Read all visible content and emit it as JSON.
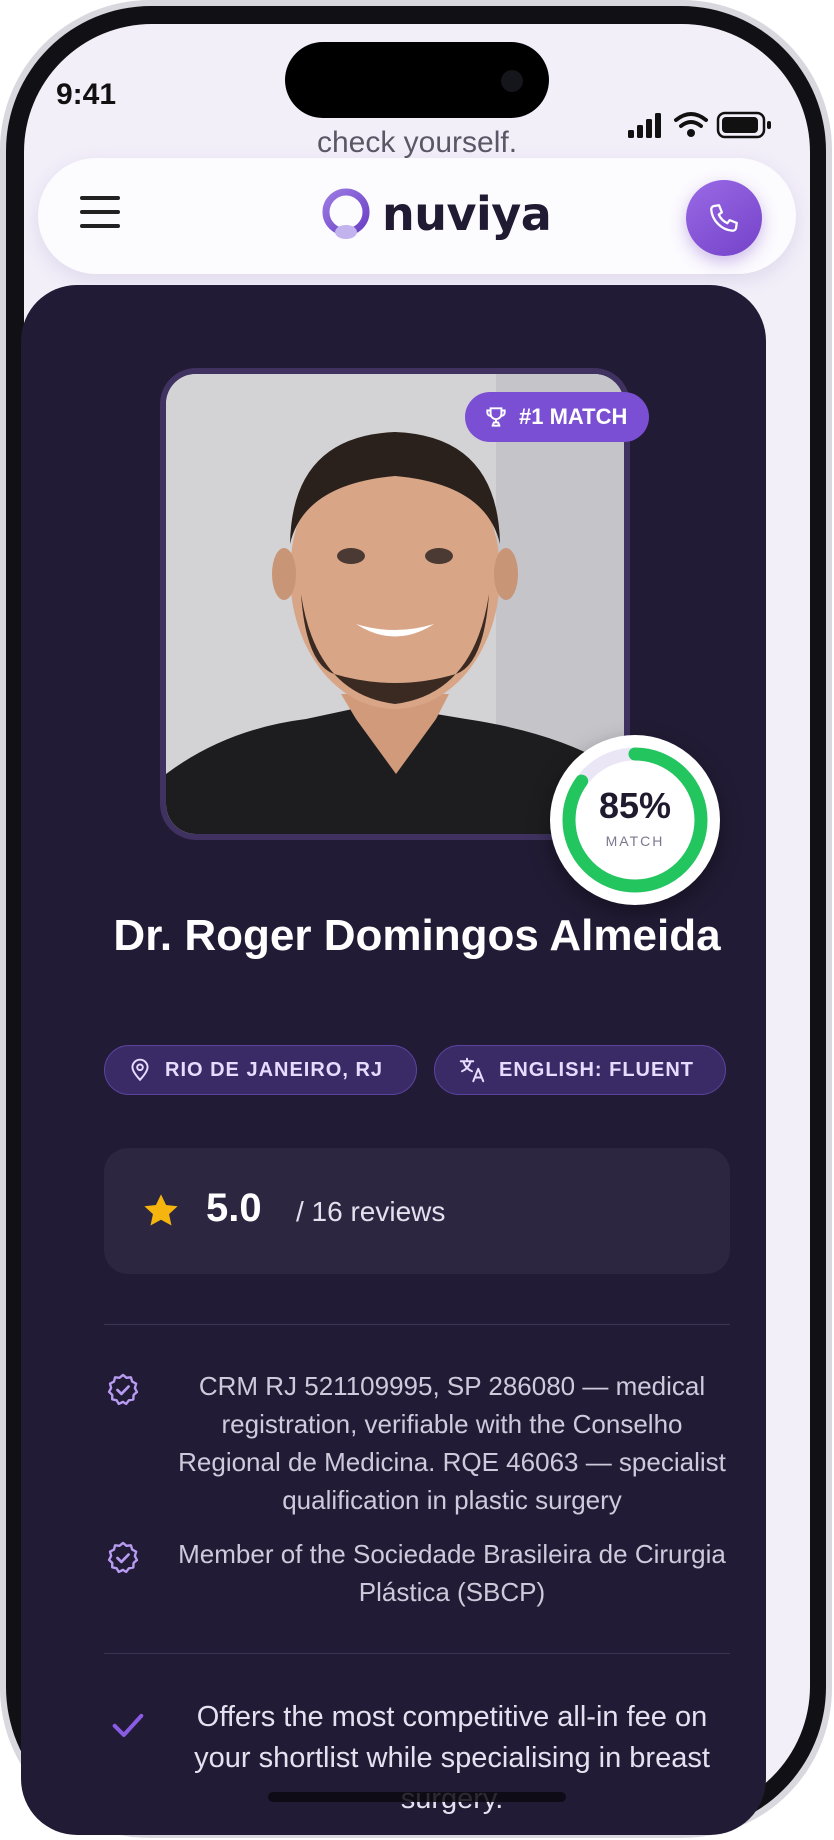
{
  "status_bar": {
    "time": "9:41"
  },
  "background": {
    "peek_text": "check yourself."
  },
  "header": {
    "logo_text": "nuviya"
  },
  "doctor": {
    "match_badge": "#1 MATCH",
    "match_percent": "85%",
    "match_value": 0.85,
    "match_label": "MATCH",
    "name": "Dr. Roger Domingos Almeida",
    "location": "RIO DE JANEIRO, RJ",
    "language": "ENGLISH: FLUENT",
    "rating": "5.0",
    "reviews": "/ 16 reviews"
  },
  "credentials": [
    {
      "text": "CRM RJ 521109995, SP 286080 — medical registration, verifiable with the Conselho Regional de Medicina. RQE 46063 — specialist qualification in plastic surgery"
    },
    {
      "text": "Member of the Sociedade Brasileira de Cirurgia Plástica (SBCP)"
    }
  ],
  "benefits": [
    {
      "text": "Offers the most competitive all-in fee on your shortlist while specialising in breast surgery."
    }
  ],
  "colors": {
    "accent": "#7b4fd3",
    "card": "#221b35",
    "match_ring": "#22c55e",
    "star": "#f5b50e"
  }
}
